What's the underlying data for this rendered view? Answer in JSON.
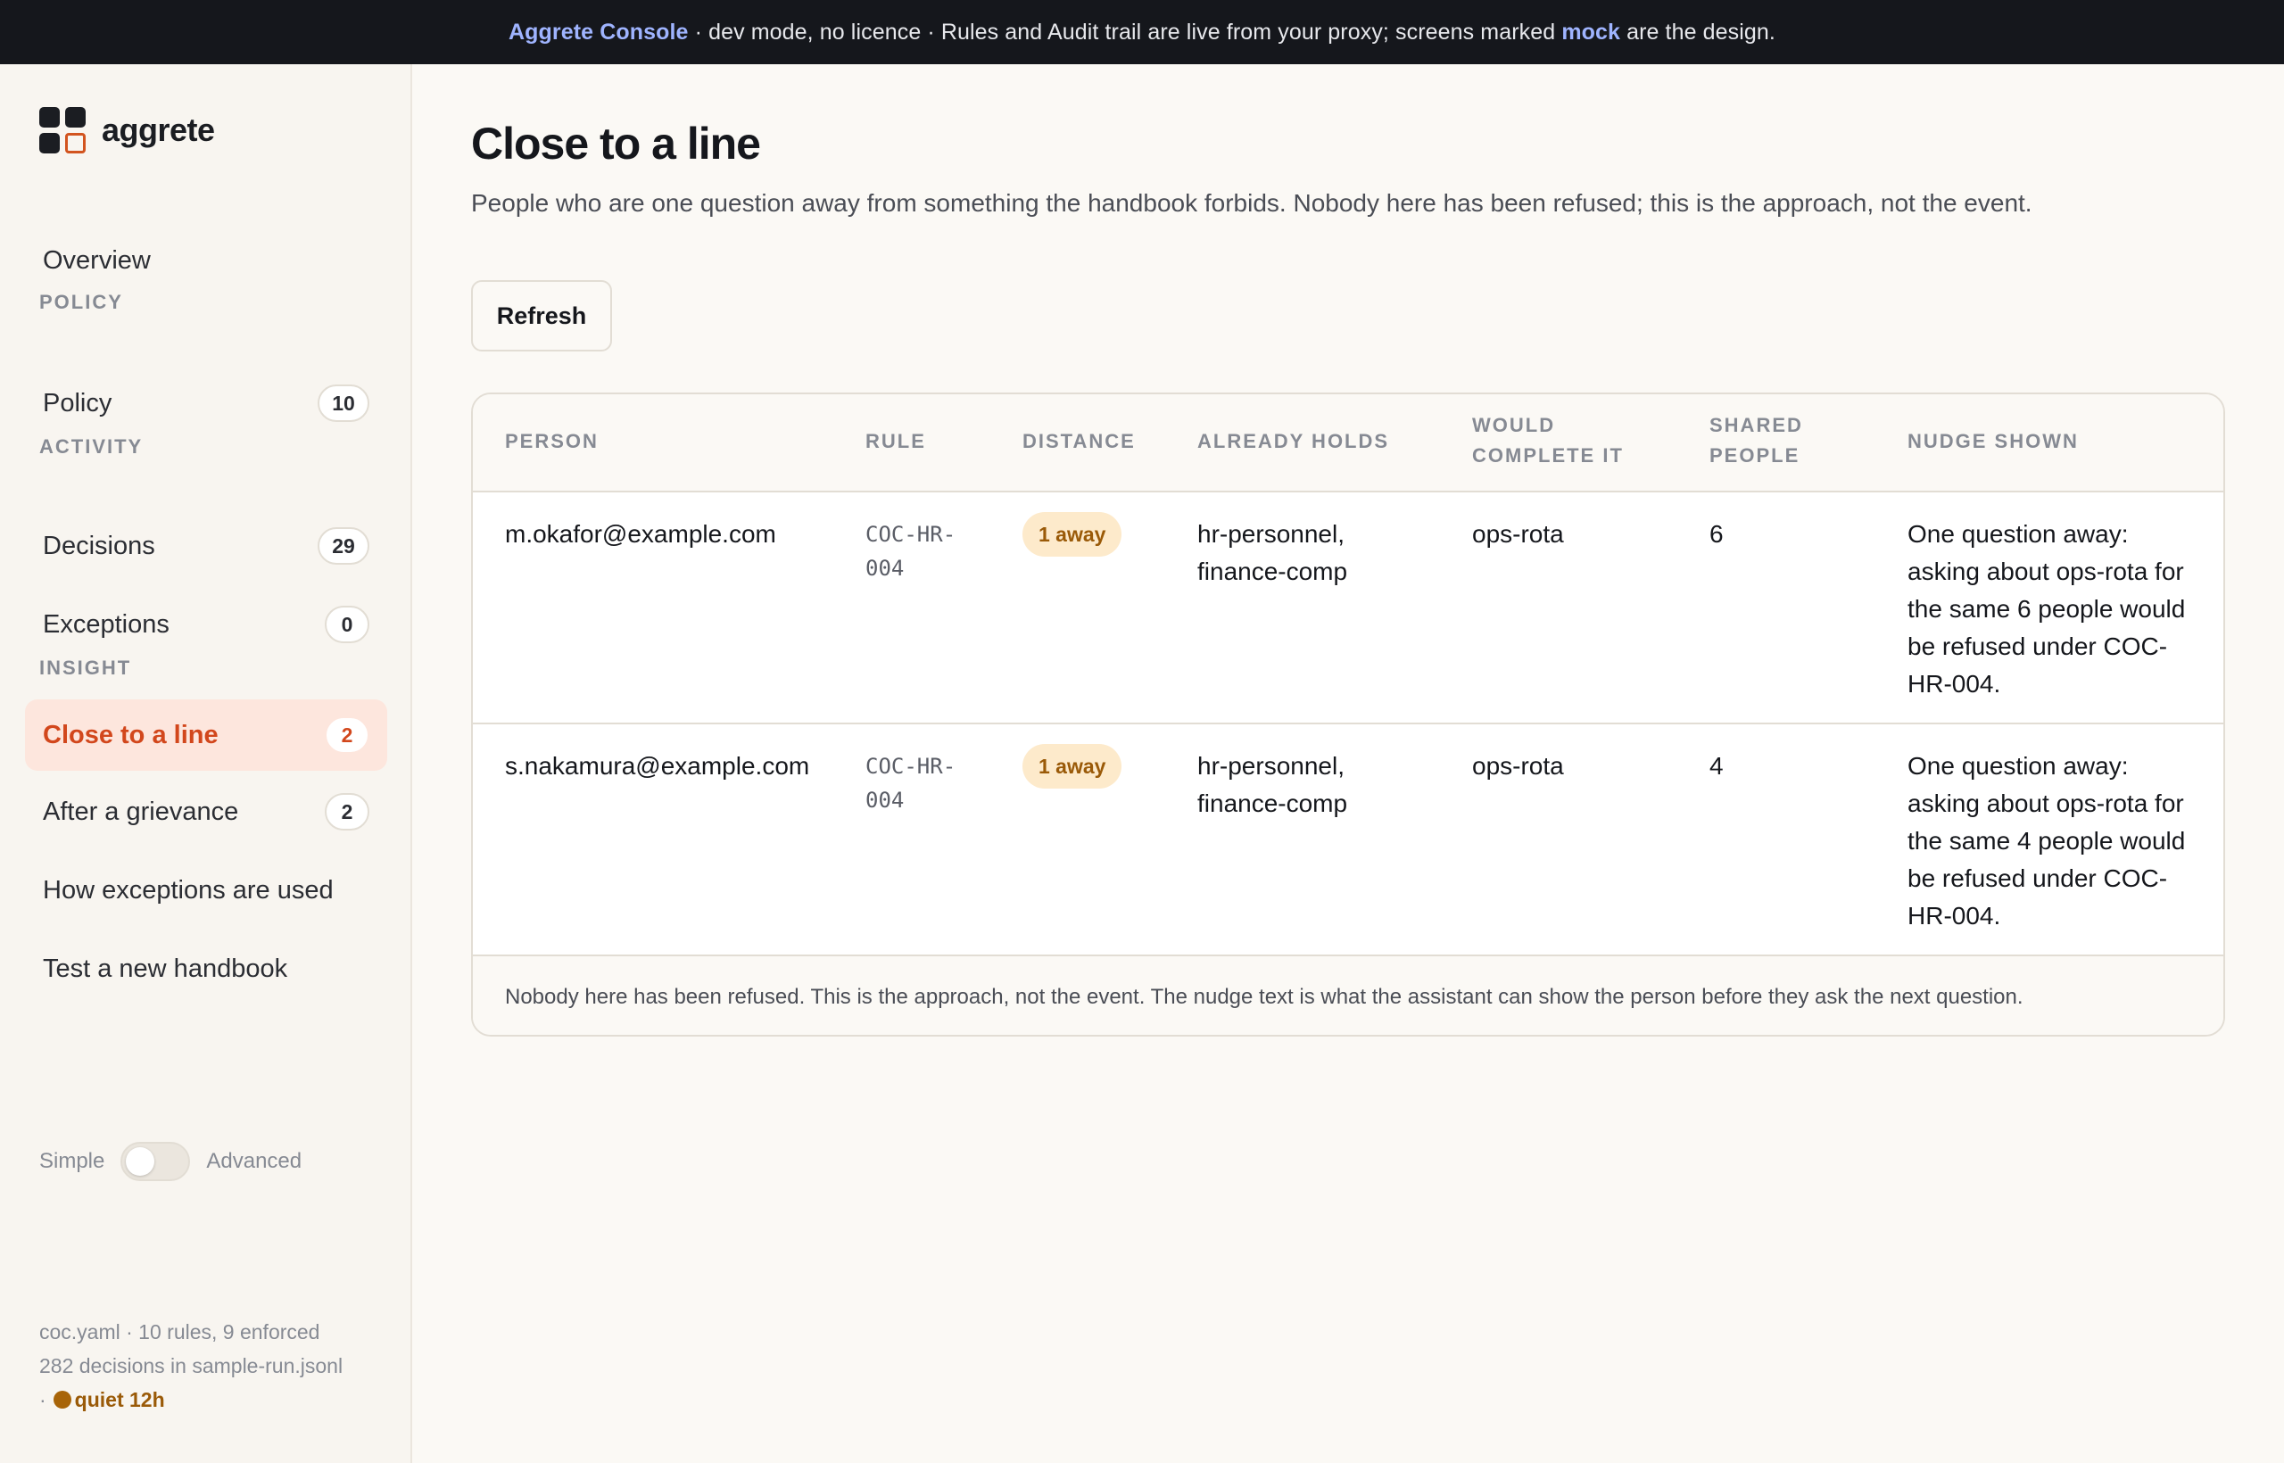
{
  "banner": {
    "brand": "Aggrete Console",
    "text_before": " · dev mode, no licence · Rules and Audit trail are live from your proxy; screens marked ",
    "mock": "mock",
    "text_after": " are the design."
  },
  "sidebar": {
    "logo_text": "aggrete",
    "overview": "Overview",
    "sections": {
      "policy": "POLICY",
      "activity": "ACTIVITY",
      "insight": "INSIGHT"
    },
    "items": [
      {
        "label": "Policy",
        "badge": "10"
      },
      {
        "label": "Decisions",
        "badge": "29"
      },
      {
        "label": "Exceptions",
        "badge": "0"
      },
      {
        "label": "Close to a line",
        "badge": "2"
      },
      {
        "label": "After a grievance",
        "badge": "2"
      },
      {
        "label": "How exceptions are used"
      },
      {
        "label": "Test a new handbook"
      }
    ],
    "toggle": {
      "left": "Simple",
      "right": "Advanced"
    },
    "footer": {
      "line1": "coc.yaml · 10 rules, 9 enforced",
      "line2": "282 decisions in sample-run.jsonl",
      "line3_prefix": "·",
      "quiet": "quiet 12h"
    }
  },
  "main": {
    "title": "Close to a line",
    "subtitle": "People who are one question away from something the handbook forbids. Nobody here has been refused; this is the approach, not the event.",
    "refresh_label": "Refresh",
    "table": {
      "headers": {
        "person": "PERSON",
        "rule": "RULE",
        "distance": "DISTANCE",
        "already_holds": "ALREADY HOLDS",
        "would_complete_1": "WOULD",
        "would_complete_2": "COMPLETE IT",
        "shared_1": "SHARED",
        "shared_2": "PEOPLE",
        "nudge": "NUDGE SHOWN"
      },
      "rows": [
        {
          "person": "m.okafor@example.com",
          "rule_1": "COC-HR-",
          "rule_2": "004",
          "distance": "1 away",
          "holds_1": "hr-personnel,",
          "holds_2": "finance-comp",
          "would_complete": "ops-rota",
          "shared": "6",
          "nudge_1": "One question away:",
          "nudge_2": "asking about ops-rota for",
          "nudge_3": "the same 6 people would",
          "nudge_4": "be refused under COC-",
          "nudge_5": "HR-004."
        },
        {
          "person": "s.nakamura@example.com",
          "rule_1": "COC-HR-",
          "rule_2": "004",
          "distance": "1 away",
          "holds_1": "hr-personnel,",
          "holds_2": "finance-comp",
          "would_complete": "ops-rota",
          "shared": "4",
          "nudge_1": "One question away:",
          "nudge_2": "asking about ops-rota for",
          "nudge_3": "the same 4 people would",
          "nudge_4": "be refused under COC-",
          "nudge_5": "HR-004."
        }
      ],
      "note": "Nobody here has been refused. This is the approach, not the event. The nudge text is what the assistant can show the person before they ask the next question."
    }
  }
}
